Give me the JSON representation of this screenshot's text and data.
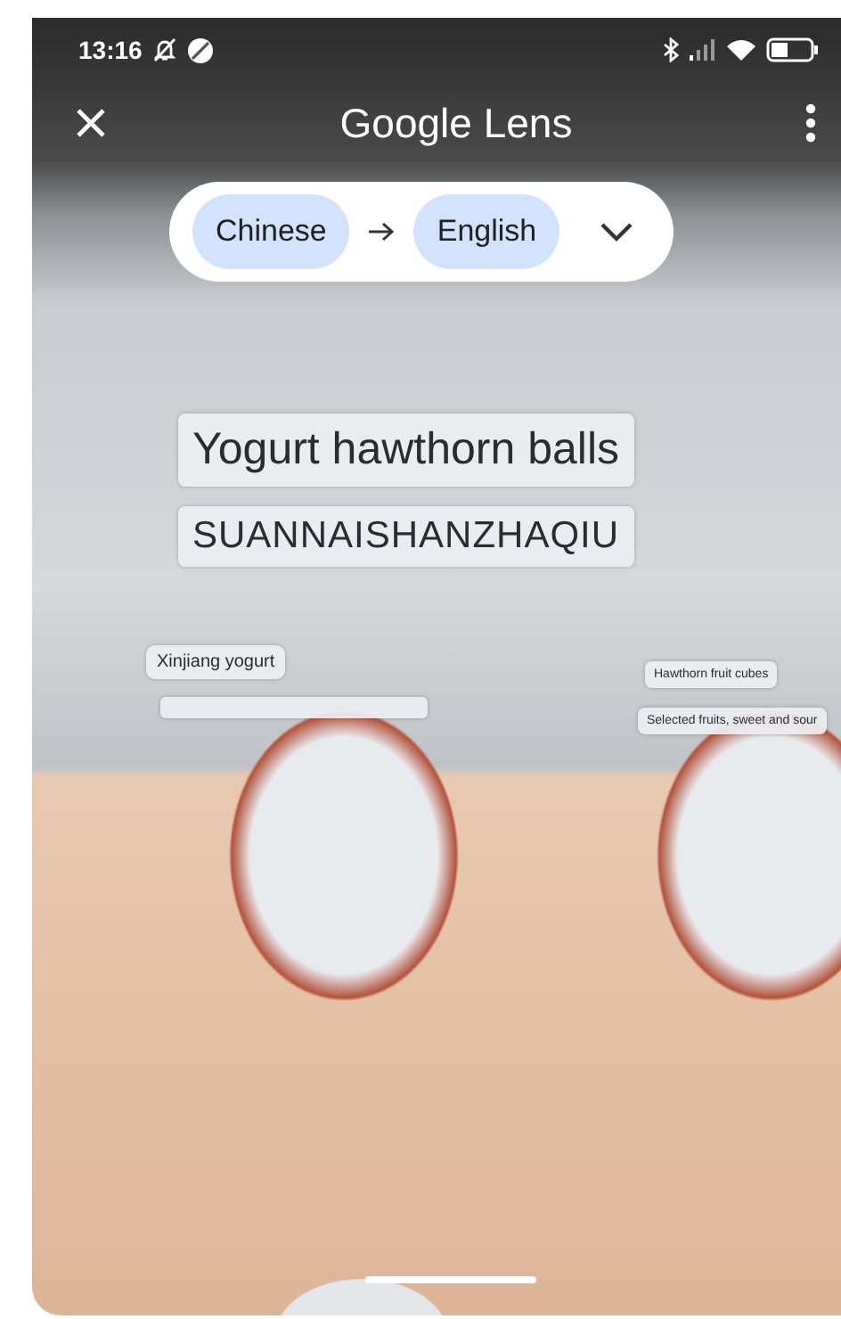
{
  "status_bar": {
    "time": "13:16"
  },
  "header": {
    "title": "Google Lens"
  },
  "language_bar": {
    "source": "Chinese",
    "target": "English"
  },
  "overlays": [
    {
      "kind": "large",
      "text": "Yogurt hawthorn balls"
    },
    {
      "kind": "medium",
      "text": "SUANNAISHANZHAQIU"
    },
    {
      "kind": "small",
      "text": "Xinjiang yogurt"
    },
    {
      "kind": "blank"
    },
    {
      "kind": "tiny",
      "text": "Hawthorn fruit cubes"
    },
    {
      "kind": "tiny",
      "text": "Selected fruits, sweet and sour"
    }
  ]
}
